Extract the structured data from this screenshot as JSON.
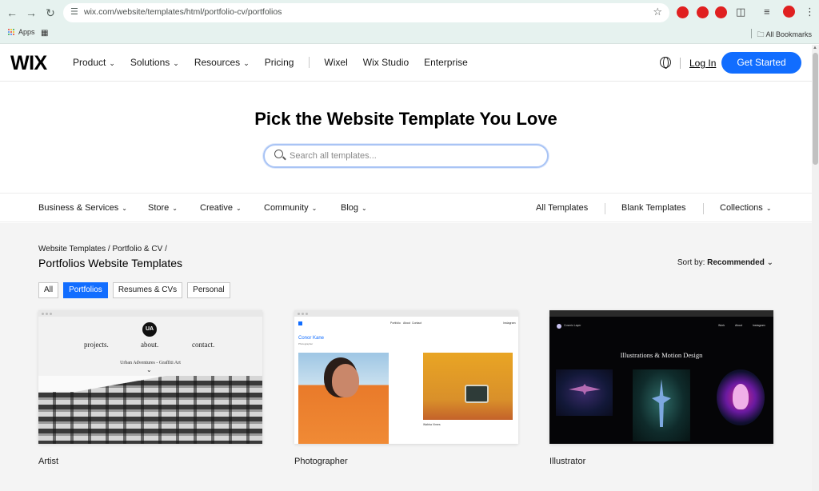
{
  "browser": {
    "url": "wix.com/website/templates/html/portfolio-cv/portfolios",
    "bookmarks": {
      "apps_label": "Apps",
      "all_bookmarks_label": "All Bookmarks"
    },
    "extension_dot_color": "#e02020"
  },
  "header": {
    "logo": "WIX",
    "nav": [
      {
        "label": "Product",
        "has_dropdown": true
      },
      {
        "label": "Solutions",
        "has_dropdown": true
      },
      {
        "label": "Resources",
        "has_dropdown": true
      },
      {
        "label": "Pricing",
        "has_dropdown": false
      }
    ],
    "nav_secondary": [
      {
        "label": "Wixel"
      },
      {
        "label": "Wix Studio"
      },
      {
        "label": "Enterprise"
      }
    ],
    "login_label": "Log In",
    "cta_label": "Get Started",
    "accent_color": "#116dff"
  },
  "hero": {
    "title": "Pick the Website Template You Love",
    "search_placeholder": "Search all templates..."
  },
  "categories": {
    "left": [
      {
        "label": "Business & Services"
      },
      {
        "label": "Store"
      },
      {
        "label": "Creative"
      },
      {
        "label": "Community"
      },
      {
        "label": "Blog"
      }
    ],
    "right": [
      {
        "label": "All Templates"
      },
      {
        "label": "Blank Templates"
      },
      {
        "label": "Collections"
      }
    ]
  },
  "listing": {
    "breadcrumb": [
      "Website Templates",
      "Portfolio & CV"
    ],
    "page_title": "Portfolios Website Templates",
    "sort_label": "Sort by:",
    "sort_value": "Recommended",
    "filters": [
      {
        "label": "All",
        "active": false
      },
      {
        "label": "Portfolios",
        "active": true
      },
      {
        "label": "Resumes & CVs",
        "active": false
      },
      {
        "label": "Personal",
        "active": false
      }
    ],
    "cards": [
      {
        "name": "Artist",
        "preview": {
          "badge": "UA",
          "nav": [
            "projects.",
            "about.",
            "contact."
          ],
          "subtitle": "Urban Adventures - Graffiti Art"
        }
      },
      {
        "name": "Photographer",
        "preview": {
          "nav": [
            "Portfolio",
            "About",
            "Contact"
          ],
          "nav_right": "Instagram",
          "person": "Conor Kane",
          "role": "Photographer",
          "caption": "Wabba Vimes"
        }
      },
      {
        "name": "Illustrator",
        "preview": {
          "site_name": "Cosmic Layer",
          "nav": [
            "Work",
            "About",
            "Instagram"
          ],
          "title": "Illustrations & Motion Design"
        }
      }
    ]
  }
}
